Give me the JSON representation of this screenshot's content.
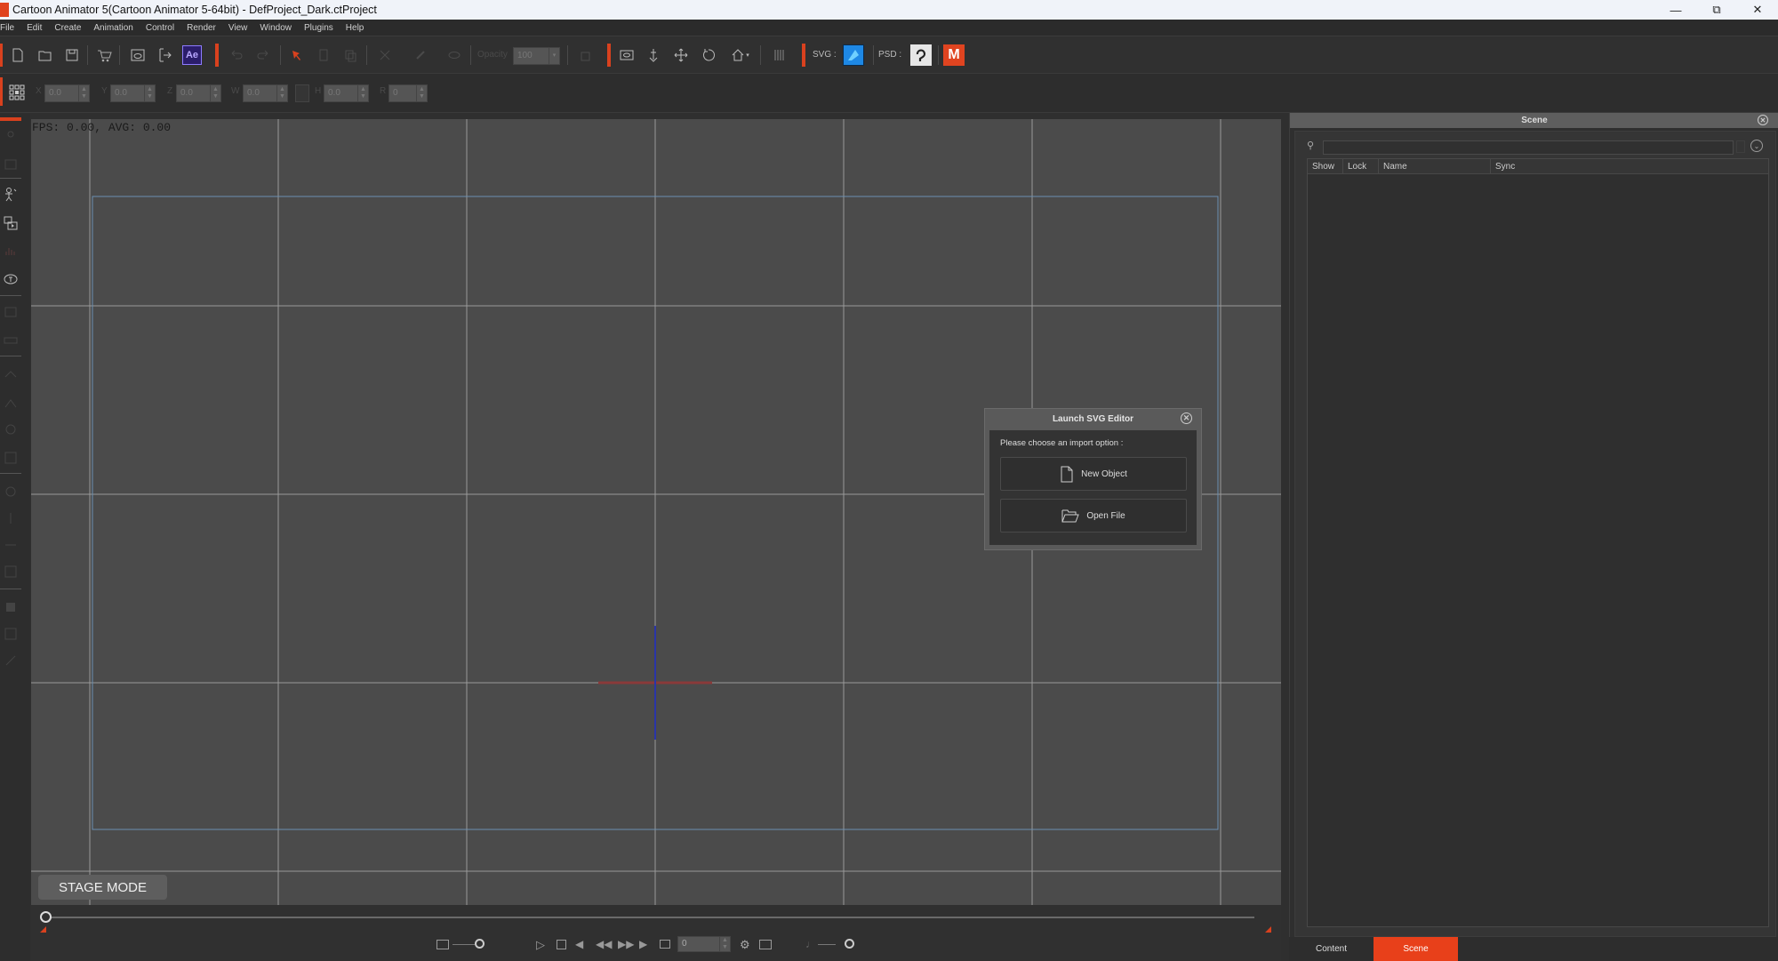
{
  "window": {
    "title": "Cartoon Animator 5(Cartoon Animator 5-64bit) - DefProject_Dark.ctProject",
    "controls": [
      "minimize",
      "restore",
      "close"
    ]
  },
  "menu": [
    "File",
    "Edit",
    "Create",
    "Animation",
    "Control",
    "Render",
    "View",
    "Window",
    "Plugins",
    "Help"
  ],
  "toolbar": {
    "opacity_label": "Opacity",
    "opacity_value": "100",
    "svg_label": "SVG :",
    "psd_label": "PSD :",
    "ae_label": "Ae",
    "icons": [
      "new-file-icon",
      "open-folder-icon",
      "save-icon",
      "store-cart-icon",
      "preview-icon",
      "export-icon",
      "after-effects-icon",
      "undo-icon",
      "redo-icon",
      "select-arrow-icon",
      "delete-icon",
      "duplicate-icon",
      "cut-icon",
      "link-icon",
      "visibility-icon",
      "transform-icon",
      "camera-icon",
      "anchor-icon",
      "move-icon",
      "rotate-icon",
      "home-icon",
      "flip-icon",
      "affinity-designer-icon",
      "clip-studio-icon",
      "m-plugin-icon"
    ]
  },
  "transform": {
    "fields": [
      {
        "label": "X",
        "value": "0.0"
      },
      {
        "label": "Y",
        "value": "0.0"
      },
      {
        "label": "Z",
        "value": "0.0"
      },
      {
        "label": "W",
        "value": "0.0"
      },
      {
        "label": "H",
        "value": "0.0"
      },
      {
        "label": "R",
        "value": "0"
      }
    ]
  },
  "viewport": {
    "fps_text": "FPS: 0.00, AVG: 0.00",
    "mode_label": "STAGE MODE"
  },
  "dialog": {
    "title": "Launch SVG Editor",
    "prompt": "Please choose an import option :",
    "buttons": [
      "New Object",
      "Open File"
    ]
  },
  "playback": {
    "frame_value": "0"
  },
  "scene_panel": {
    "title": "Scene",
    "search_placeholder": "",
    "columns": [
      "Show",
      "Lock",
      "Name",
      "Sync"
    ],
    "rows": []
  },
  "bottom_tabs": [
    {
      "label": "Content",
      "active": false
    },
    {
      "label": "Scene",
      "active": true
    }
  ],
  "colors": {
    "accent": "#e8401a",
    "viewport_bg": "#4b4b4b",
    "grid_line": "#9a9a9a",
    "stage_border": "#6b8fb0",
    "axis_x": "#8a3a3a",
    "axis_y": "#2a35a8"
  }
}
